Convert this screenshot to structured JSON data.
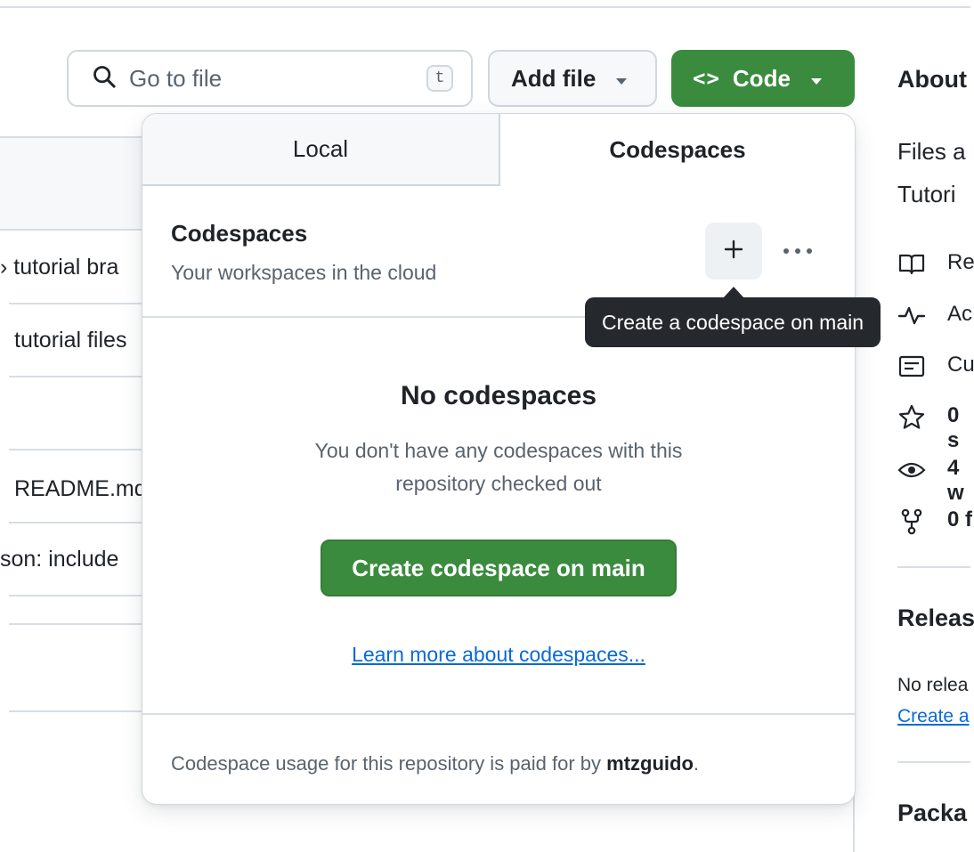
{
  "toolbar": {
    "search_placeholder": "Go to file",
    "search_shortcut": "t",
    "add_file_label": "Add file",
    "code_label": "Code",
    "code_glyph": "<>"
  },
  "file_list": {
    "rows": [
      "› tutorial bra",
      "tutorial files",
      "README.md",
      "son: include"
    ]
  },
  "sidebar": {
    "about_heading": "About",
    "description_lines": [
      "Files a",
      "Tutori"
    ],
    "readme": "Re",
    "activity": "Ac",
    "custom": "Cu",
    "stars": "0 s",
    "watching": "4 w",
    "forks": "0 f",
    "releases_heading": "Releas",
    "releases_text": "No relea",
    "releases_link": "Create a",
    "packages_heading": "Packa"
  },
  "popover": {
    "tabs": [
      {
        "label": "Local",
        "selected": false
      },
      {
        "label": "Codespaces",
        "selected": true
      }
    ],
    "section_title": "Codespaces",
    "section_subtitle": "Your workspaces in the cloud",
    "empty_title": "No codespaces",
    "empty_description": "You don't have any codespaces with this repository checked out",
    "create_button": "Create codespace on main",
    "learn_more": "Learn more about codespaces...",
    "footer_prefix": "Codespace usage for this repository is paid for by ",
    "footer_owner": "mtzguido",
    "footer_suffix": "."
  },
  "tooltip": {
    "text": "Create a codespace on main"
  },
  "colors": {
    "primary_green": "#3a8b3e",
    "link_blue": "#0969da",
    "tooltip_bg": "#25292e",
    "muted_text": "#59636e"
  }
}
